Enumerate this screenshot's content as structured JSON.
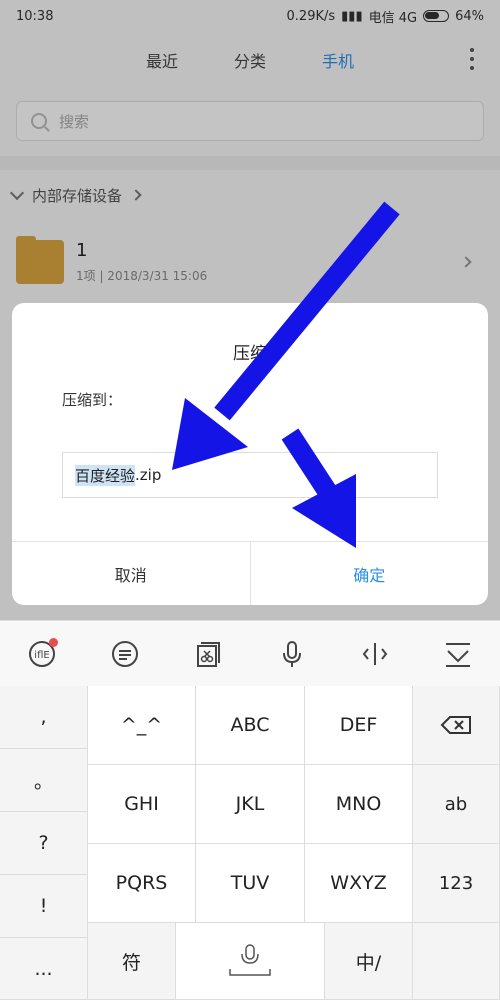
{
  "status_bar": {
    "time": "10:38",
    "network_speed": "0.29K/s",
    "carrier": "电信 4G",
    "battery": "64%"
  },
  "tabs": [
    {
      "label": "最近"
    },
    {
      "label": "分类"
    },
    {
      "label": "手机",
      "active": true
    }
  ],
  "search": {
    "placeholder": "搜索"
  },
  "breadcrumb": {
    "label": "内部存储设备"
  },
  "file": {
    "name": "1",
    "meta": "1项 | 2018/3/31 15:06"
  },
  "dialog": {
    "title": "压缩",
    "label": "压缩到：",
    "input_selected": "百度经验",
    "input_ext": ".zip",
    "cancel_label": "取消",
    "confirm_label": "确定"
  },
  "keyboard": {
    "left_keys": [
      ",",
      "。",
      "?",
      "!",
      "..."
    ],
    "rows": [
      [
        "^_^",
        "ABC",
        "DEF"
      ],
      [
        "GHI",
        "JKL",
        "MNO"
      ],
      [
        "PQRS",
        "TUV",
        "WXYZ"
      ]
    ],
    "right_keys": [
      "ab",
      "123"
    ],
    "symbol_key": "符",
    "lang_key": "中/"
  },
  "colors": {
    "accent": "#2b8ee8",
    "arrow": "#1414e6",
    "folder": "#d9a441"
  },
  "icons": [
    "search-icon",
    "more-icon",
    "chevron-down-icon",
    "chevron-right-icon",
    "folder-icon",
    "emoji-icon",
    "chat-bubble-icon",
    "clipboard-icon",
    "microphone-icon",
    "cursor-icon",
    "collapse-keyboard-icon",
    "backspace-icon"
  ]
}
